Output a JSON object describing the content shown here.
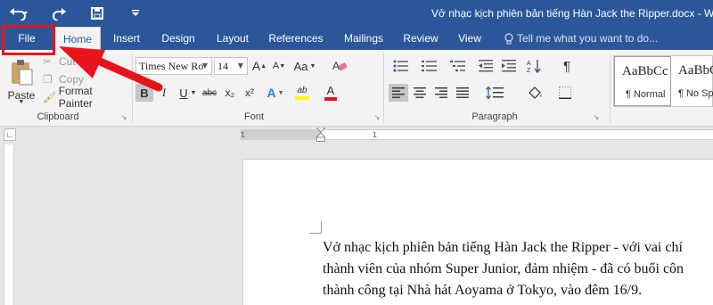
{
  "titlebar": {
    "title": "Vở nhạc kịch phiên bản tiếng Hàn Jack the Ripper.docx - Word",
    "qat": [
      "undo-icon",
      "redo-icon",
      "save-icon",
      "customize-icon"
    ]
  },
  "tabs": [
    "File",
    "Home",
    "Insert",
    "Design",
    "Layout",
    "References",
    "Mailings",
    "Review",
    "View"
  ],
  "tell_me": "Tell me what you want to do...",
  "clipboard": {
    "paste": "Paste",
    "cut": "Cut",
    "copy": "Copy",
    "format_painter": "Format Painter",
    "label": "Clipboard"
  },
  "font": {
    "name": "Times New Ro",
    "size": "14",
    "grow": "A",
    "shrink": "A",
    "case": "Aa",
    "bold": "B",
    "italic": "I",
    "underline": "U",
    "strike": "abc",
    "subscript": "x₂",
    "superscript": "x²",
    "text_effects": "A",
    "highlight": "ab",
    "font_color": "A",
    "label": "Font"
  },
  "paragraph": {
    "label": "Paragraph",
    "pilcrow": "¶"
  },
  "styles": [
    {
      "preview": "AaBbCc",
      "name": "¶ Normal"
    },
    {
      "preview": "AaBbC",
      "name": "¶ No Sp"
    }
  ],
  "ruler": {
    "numbers": [
      "1",
      "1"
    ]
  },
  "document": {
    "lines": [
      "Vở nhạc kịch phiên bản tiếng Hàn Jack the Ripper - với vai chí",
      "thành viên của nhóm Super Junior, đảm nhiệm - đã có buổi côn",
      "thành công tại Nhà hát Aoyama ở Tokyo, vào đêm 16/9."
    ]
  },
  "colors": {
    "title_bar": "#2b579a",
    "ribbon": "#f3f3f3",
    "annotation": "#e8141c",
    "highlight_yellow": "#ffff00",
    "font_red": "#e81123"
  }
}
